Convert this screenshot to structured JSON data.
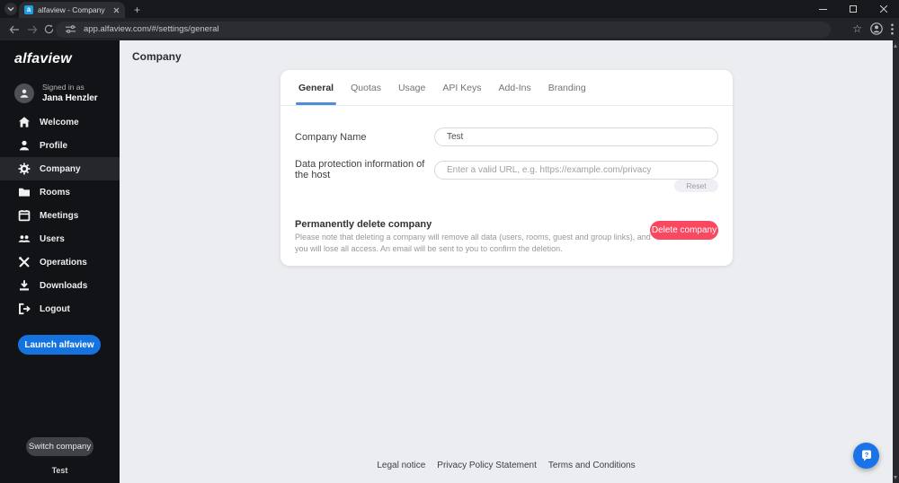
{
  "browser": {
    "tab_title": "alfaview - Company",
    "favicon_letter": "a",
    "url": "app.alfaview.com/#/settings/general"
  },
  "sidebar": {
    "logo": "alfaview",
    "signed_in_as": "Signed in as",
    "user_name": "Jana Henzler",
    "nav": [
      {
        "label": "Welcome"
      },
      {
        "label": "Profile"
      },
      {
        "label": "Company"
      },
      {
        "label": "Rooms"
      },
      {
        "label": "Meetings"
      },
      {
        "label": "Users"
      },
      {
        "label": "Operations"
      },
      {
        "label": "Downloads"
      },
      {
        "label": "Logout"
      }
    ],
    "launch_button": "Launch alfaview",
    "switch_company_button": "Switch company",
    "current_company": "Test"
  },
  "main": {
    "page_title": "Company",
    "tabs": [
      {
        "label": "General"
      },
      {
        "label": "Quotas"
      },
      {
        "label": "Usage"
      },
      {
        "label": "API Keys"
      },
      {
        "label": "Add-Ins"
      },
      {
        "label": "Branding"
      }
    ],
    "form": {
      "company_name_label": "Company Name",
      "company_name_value": "Test",
      "privacy_label": "Data protection information of the host",
      "privacy_placeholder": "Enter a valid URL, e.g. https://example.com/privacy",
      "reset_button": "Reset"
    },
    "delete_section": {
      "title": "Permanently delete company",
      "description": "Please note that deleting a company will remove all data (users, rooms, guest and group links), and you will lose all access. An email will be sent to you to confirm the deletion.",
      "button": "Delete company"
    }
  },
  "footer": {
    "links": [
      "Legal notice",
      "Privacy Policy Statement",
      "Terms and Conditions"
    ]
  },
  "colors": {
    "accent_blue": "#1a73e8",
    "launch_blue": "#1573e0",
    "tab_underline_blue": "#4a90d5",
    "delete_red": "#f9485f"
  }
}
